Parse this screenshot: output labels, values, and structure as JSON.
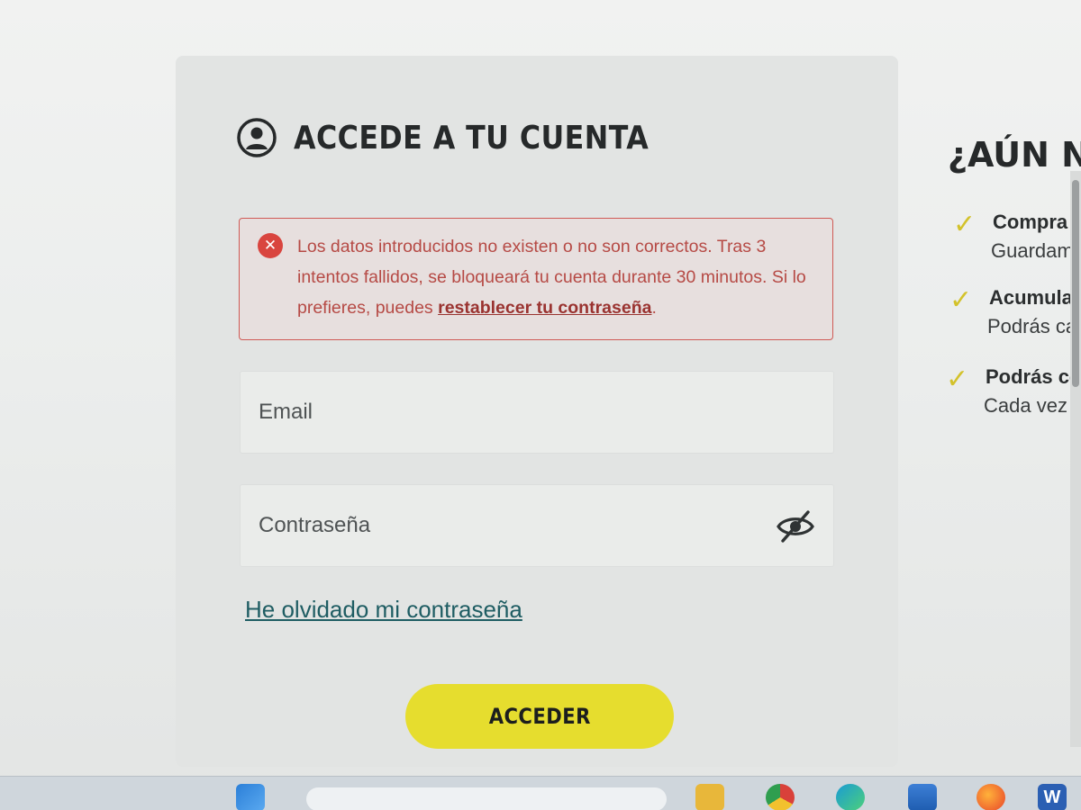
{
  "login": {
    "title": "ACCEDE A TU CUENTA",
    "error": {
      "text": "Los datos introducidos no existen o no son correctos. Tras 3 intentos fallidos, se bloqueará tu cuenta durante 30 minutos. Si lo prefieres, puedes ",
      "link_text": "restablecer tu contraseña",
      "suffix": "."
    },
    "email_placeholder": "Email",
    "password_placeholder": "Contraseña",
    "forgot_link": "He olvidado mi contraseña",
    "submit_label": "ACCEDER"
  },
  "promo": {
    "title": "¿AÚN NO",
    "benefits": [
      {
        "title": "Compra r",
        "desc": "Guardam"
      },
      {
        "title": "Acumula",
        "desc": "Podrás ca"
      },
      {
        "title": "Podrás co",
        "desc": "Cada vez c"
      }
    ]
  },
  "taskbar": {
    "word_letter": "W"
  },
  "colors": {
    "accent_yellow": "#e6dd2e",
    "error_red": "#d9453f",
    "link_teal": "#1f5d63"
  },
  "icons": [
    "user-circle-icon",
    "error-x-icon",
    "eye-slash-icon",
    "check-icon"
  ]
}
